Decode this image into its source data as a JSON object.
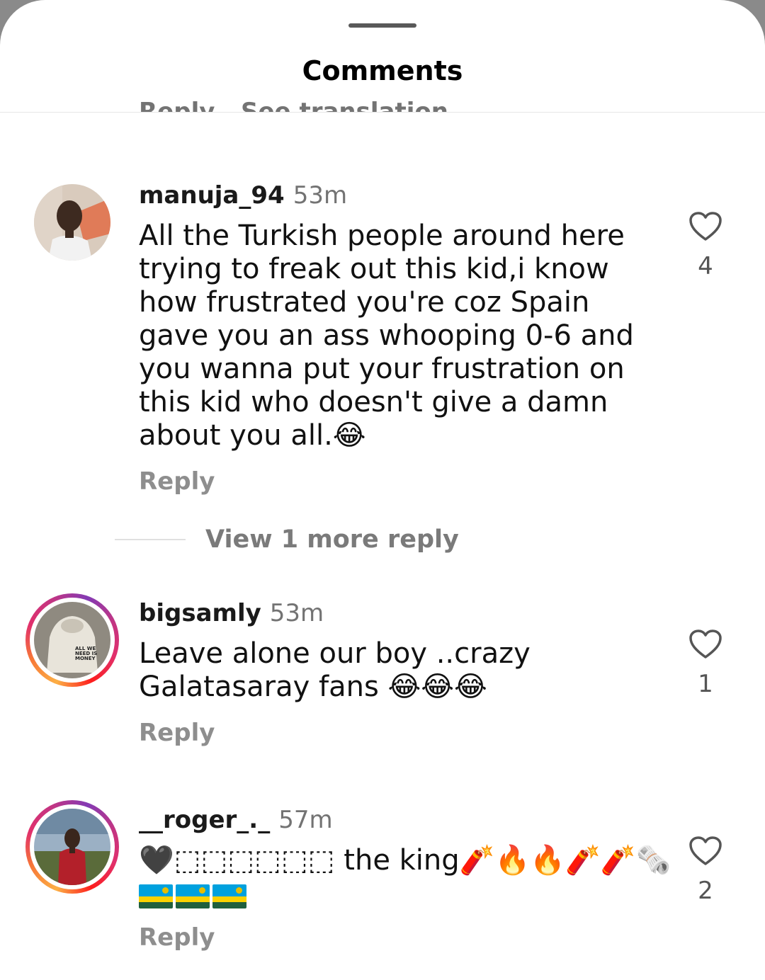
{
  "sheet": {
    "title": "Comments"
  },
  "cut_row": {
    "reply_label": "Reply",
    "translation_label": "See translation"
  },
  "comments": [
    {
      "username": "manuja_94",
      "time": "53m",
      "text": "All the Turkish people around here trying to freak out this kid,i know how frustrated you're coz Spain gave you an ass whooping 0-6 and you wanna put your frustration on this kid who doesn't give a damn about you all.😂",
      "likes": "4",
      "reply_label": "Reply",
      "has_story_ring": false
    },
    {
      "username": "bigsamly",
      "time": "53m",
      "text": "Leave alone  our boy ..crazy Galatasaray fans 😂😂😂",
      "likes": "1",
      "reply_label": "Reply",
      "has_story_ring": true
    },
    {
      "username": "__roger_._",
      "time": "57m",
      "text": "🖤⬚⬚⬚⬚⬚⬚ the king🧨🔥🔥🧨🧨🗞️",
      "flags": "🇷🇼🇷🇼🇷🇼",
      "likes": "2",
      "reply_label": "Reply",
      "has_story_ring": true
    }
  ],
  "view_more": {
    "label": "View 1 more reply"
  },
  "icons": {
    "like": "heart-outline-icon",
    "drag": "grab-handle"
  },
  "colors": {
    "text": "#111111",
    "muted": "#737373",
    "background": "#ffffff"
  }
}
